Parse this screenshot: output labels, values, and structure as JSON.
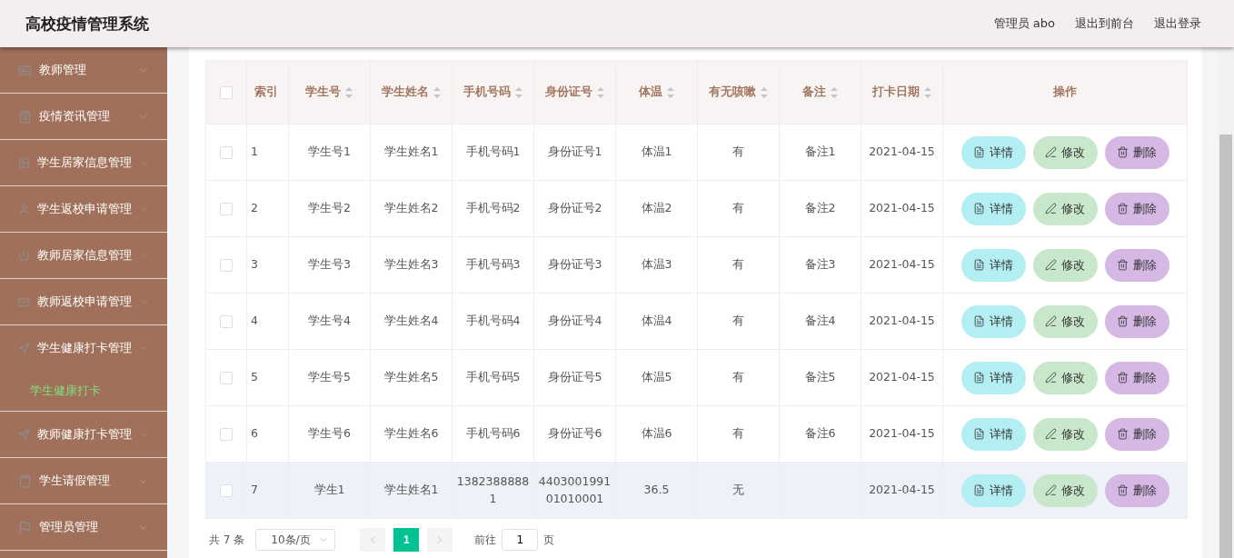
{
  "header": {
    "title": "高校疫情管理系统",
    "user": "管理员 abo",
    "links": [
      "退出到前台",
      "退出登录"
    ]
  },
  "sidebar": {
    "items": [
      {
        "label": "教师管理",
        "expanded": false
      },
      {
        "label": "疫情资讯管理",
        "expanded": false
      },
      {
        "label": "学生居家信息管理",
        "expanded": false
      },
      {
        "label": "学生返校申请管理",
        "expanded": false
      },
      {
        "label": "教师居家信息管理",
        "expanded": false
      },
      {
        "label": "教师返校申请管理",
        "expanded": false
      },
      {
        "label": "学生健康打卡管理",
        "expanded": true,
        "children": [
          {
            "label": "学生健康打卡",
            "selected": true
          }
        ]
      },
      {
        "label": "教师健康打卡管理",
        "expanded": false
      },
      {
        "label": "学生请假管理",
        "expanded": false
      },
      {
        "label": "管理员管理",
        "expanded": false
      }
    ]
  },
  "table": {
    "all_checked": false,
    "columns": [
      {
        "label": "索引",
        "sortable": false
      },
      {
        "label": "学生号",
        "sortable": true
      },
      {
        "label": "学生姓名",
        "sortable": true
      },
      {
        "label": "手机号码",
        "sortable": true
      },
      {
        "label": "身份证号",
        "sortable": true
      },
      {
        "label": "体温",
        "sortable": true
      },
      {
        "label": "有无咳嗽",
        "sortable": true
      },
      {
        "label": "备注",
        "sortable": true
      },
      {
        "label": "打卡日期",
        "sortable": true
      },
      {
        "label": "操作",
        "sortable": false
      }
    ],
    "rows": [
      {
        "checked": false,
        "highlighted": false,
        "cells": [
          "1",
          "学生号1",
          "学生姓名1",
          "手机号码1",
          "身份证号1",
          "体温1",
          "有",
          "备注1",
          "2021-04-15"
        ],
        "actions": [
          {
            "kind": "detail",
            "label": "详情"
          },
          {
            "kind": "edit",
            "label": "修改"
          },
          {
            "kind": "delete",
            "label": "删除"
          }
        ]
      },
      {
        "checked": false,
        "highlighted": false,
        "cells": [
          "2",
          "学生号2",
          "学生姓名2",
          "手机号码2",
          "身份证号2",
          "体温2",
          "有",
          "备注2",
          "2021-04-15"
        ],
        "actions": [
          {
            "kind": "detail",
            "label": "详情"
          },
          {
            "kind": "edit",
            "label": "修改"
          },
          {
            "kind": "delete",
            "label": "删除"
          }
        ]
      },
      {
        "checked": false,
        "highlighted": false,
        "cells": [
          "3",
          "学生号3",
          "学生姓名3",
          "手机号码3",
          "身份证号3",
          "体温3",
          "有",
          "备注3",
          "2021-04-15"
        ],
        "actions": [
          {
            "kind": "detail",
            "label": "详情"
          },
          {
            "kind": "edit",
            "label": "修改"
          },
          {
            "kind": "delete",
            "label": "删除"
          }
        ]
      },
      {
        "checked": false,
        "highlighted": false,
        "cells": [
          "4",
          "学生号4",
          "学生姓名4",
          "手机号码4",
          "身份证号4",
          "体温4",
          "有",
          "备注4",
          "2021-04-15"
        ],
        "actions": [
          {
            "kind": "detail",
            "label": "详情"
          },
          {
            "kind": "edit",
            "label": "修改"
          },
          {
            "kind": "delete",
            "label": "删除"
          }
        ]
      },
      {
        "checked": false,
        "highlighted": false,
        "cells": [
          "5",
          "学生号5",
          "学生姓名5",
          "手机号码5",
          "身份证号5",
          "体温5",
          "有",
          "备注5",
          "2021-04-15"
        ],
        "actions": [
          {
            "kind": "detail",
            "label": "详情"
          },
          {
            "kind": "edit",
            "label": "修改"
          },
          {
            "kind": "delete",
            "label": "删除"
          }
        ]
      },
      {
        "checked": false,
        "highlighted": false,
        "cells": [
          "6",
          "学生号6",
          "学生姓名6",
          "手机号码6",
          "身份证号6",
          "体温6",
          "有",
          "备注6",
          "2021-04-15"
        ],
        "actions": [
          {
            "kind": "detail",
            "label": "详情"
          },
          {
            "kind": "edit",
            "label": "修改"
          },
          {
            "kind": "delete",
            "label": "删除"
          }
        ]
      },
      {
        "checked": false,
        "highlighted": true,
        "cells": [
          "7",
          "学生1",
          "学生姓名1",
          "13823888881",
          "440300199101010001",
          "36.5",
          "无",
          null,
          "2021-04-15"
        ],
        "actions": [
          {
            "kind": "detail",
            "label": "详情"
          },
          {
            "kind": "edit",
            "label": "修改"
          },
          {
            "kind": "delete",
            "label": "删除"
          }
        ]
      }
    ]
  },
  "pagination": {
    "total": "共 7 条",
    "page_size": "10条/页",
    "pages": [
      {
        "label": "1",
        "selected": true
      }
    ],
    "goto_label": "前往",
    "goto_value": "1",
    "goto_suffix": "页"
  }
}
